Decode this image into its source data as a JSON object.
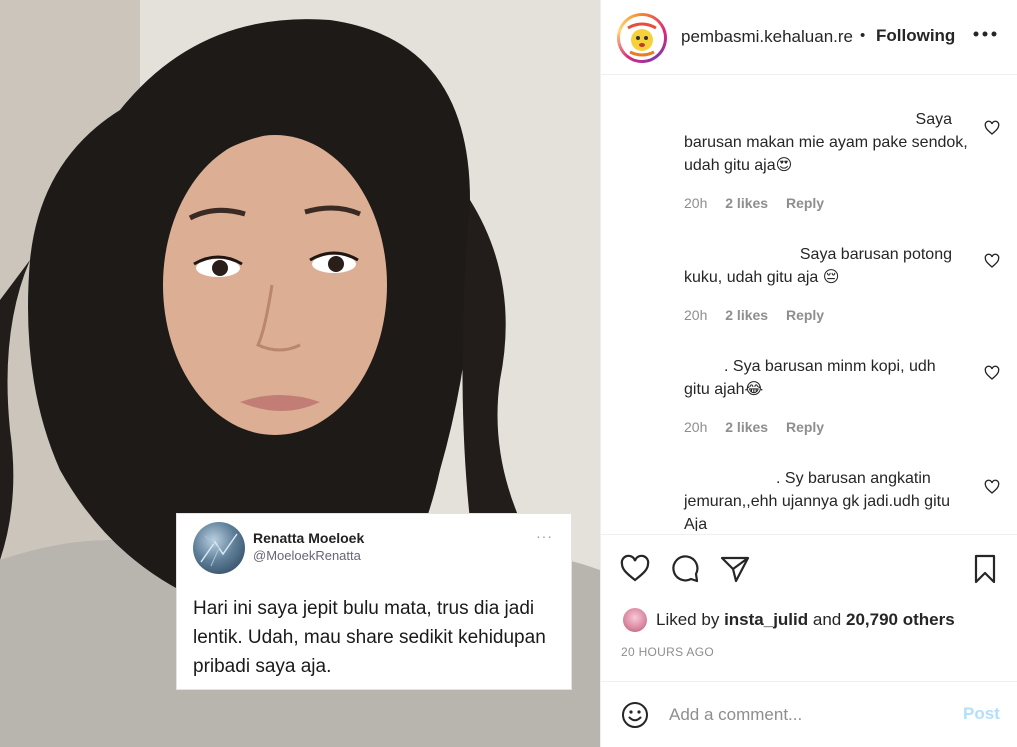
{
  "post": {
    "image_alt": "",
    "tweet": {
      "name": "Renatta Moeloek",
      "handle": "@MoeloekRenatta",
      "more": "···",
      "body": "Hari ini saya jepit bulu mata, trus dia jadi lentik. Udah, mau share sedikit kehidupan pribadi saya aja."
    }
  },
  "header": {
    "username": "pembasmi.kehaluan.re",
    "separator": "•",
    "following_label": "Following",
    "more_icon": "more-horizontal-icon"
  },
  "comments": [
    {
      "text_line1": "Saya",
      "text_rest": "barusan makan mie ayam pake sendok, udah gitu aja😍",
      "time": "20h",
      "likes": "2 likes",
      "reply": "Reply"
    },
    {
      "text_line1": "Saya barusan potong",
      "text_rest": "kuku, udah gitu aja 😔",
      "time": "20h",
      "likes": "2 likes",
      "reply": "Reply"
    },
    {
      "text_line1": ". Sya barusan minm kopi, udh",
      "text_rest": "gitu ajah😂",
      "time": "20h",
      "likes": "2 likes",
      "reply": "Reply"
    },
    {
      "text_line1": ". Sy barusan angkatin",
      "text_rest": "jemuran,,ehh ujannya gk jadi.udh gitu Aja",
      "time": "",
      "likes": "",
      "reply": ""
    }
  ],
  "actions": {
    "like_icon": "heart-icon",
    "comment_icon": "comment-icon",
    "share_icon": "send-icon",
    "save_icon": "bookmark-icon"
  },
  "likes": {
    "prefix": "Liked by",
    "user": "insta_julid",
    "and": "and",
    "others": "20,790 others"
  },
  "time_ago": "20 HOURS AGO",
  "add_comment": {
    "placeholder": "Add a comment...",
    "post_label": "Post",
    "post_color": "#b2dffc"
  }
}
